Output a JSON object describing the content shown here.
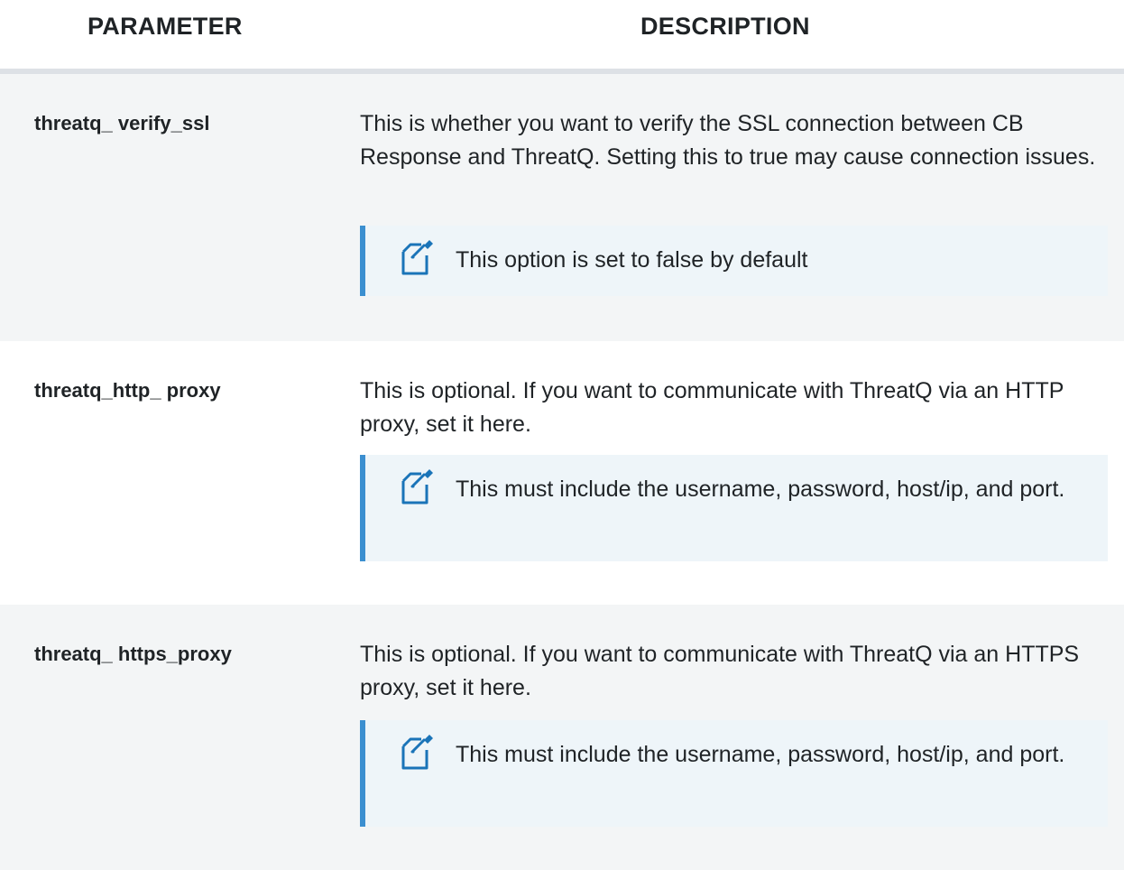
{
  "table": {
    "headers": {
      "parameter": "PARAMETER",
      "description": "DESCRIPTION"
    },
    "rows": [
      {
        "parameter": "threatq_ verify_ssl",
        "description": "This is whether you want to verify the SSL connection between CB Response and ThreatQ. Setting this to true may cause connection issues.",
        "note": "This option is set to false by default",
        "note_icon": "note-pencil-icon"
      },
      {
        "parameter": "threatq_http_ proxy",
        "description": "This is optional. If you want to communicate with ThreatQ via an HTTP proxy, set it here.",
        "note": "This must include the username, password, host/ip, and port.",
        "note_icon": "note-pencil-icon"
      },
      {
        "parameter": "threatq_ https_proxy",
        "description": "This is optional. If you want to communicate with ThreatQ via an HTTPS proxy, set it here.",
        "note": "This must include the username, password, host/ip, and port.",
        "note_icon": "note-pencil-icon"
      }
    ]
  },
  "colors": {
    "row_shaded": "#f3f5f6",
    "note_background": "#eef5f9",
    "note_accent": "#3b8fd0",
    "header_rule": "#dde1e6",
    "text": "#1f2326"
  }
}
